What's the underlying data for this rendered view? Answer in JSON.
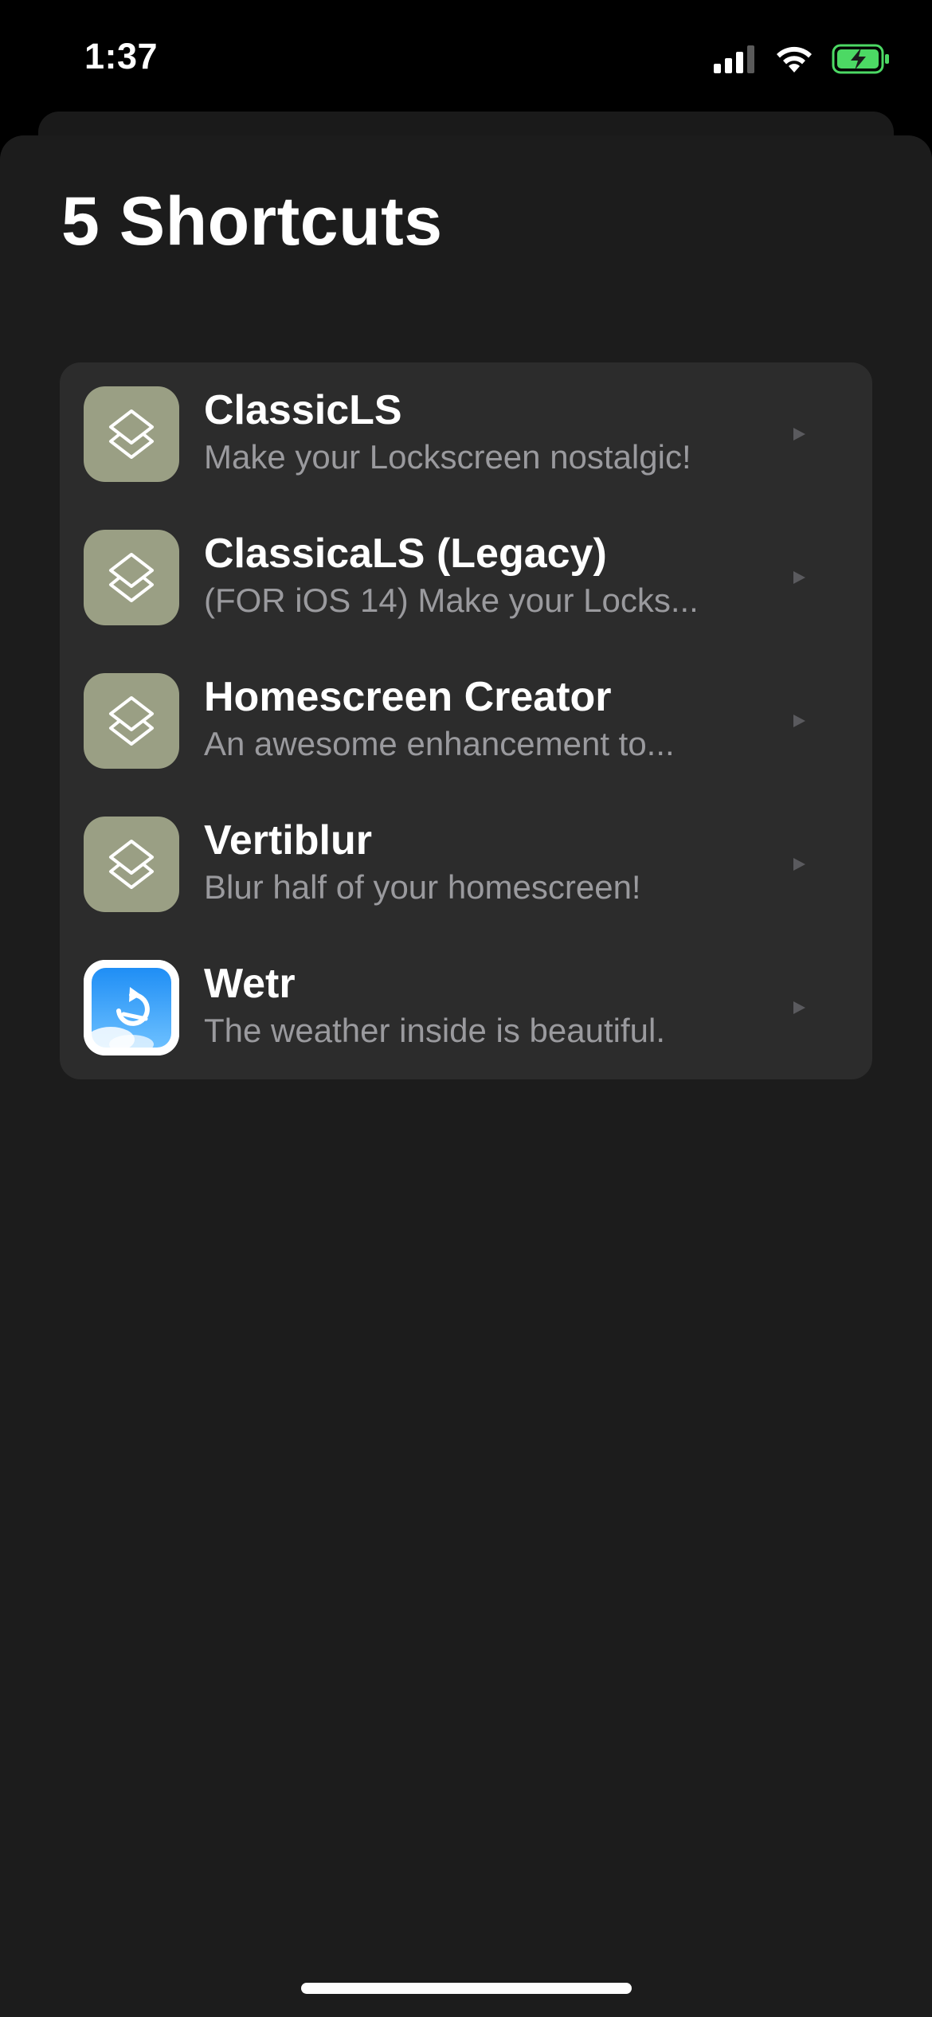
{
  "status_bar": {
    "time": "1:37"
  },
  "page": {
    "title": "5 Shortcuts"
  },
  "shortcuts": [
    {
      "title": "ClassicLS",
      "subtitle": "Make your Lockscreen nostalgic!",
      "icon": "shortcuts-icon"
    },
    {
      "title": "ClassicaLS (Legacy)",
      "subtitle": "(FOR iOS 14) Make your Locks...",
      "icon": "shortcuts-icon"
    },
    {
      "title": "Homescreen Creator",
      "subtitle": "An awesome enhancement to...",
      "icon": "shortcuts-icon"
    },
    {
      "title": "Vertiblur",
      "subtitle": "Blur half of your homescreen!",
      "icon": "shortcuts-icon"
    },
    {
      "title": "Wetr",
      "subtitle": "The weather inside is beautiful.",
      "icon": "wetr-app-icon"
    }
  ],
  "colors": {
    "background": "#1c1c1c",
    "card": "#2c2c2c",
    "shortcut_icon_bg": "#9a9f84",
    "battery_green": "#4cd964",
    "subtitle": "#9a9a9e"
  }
}
